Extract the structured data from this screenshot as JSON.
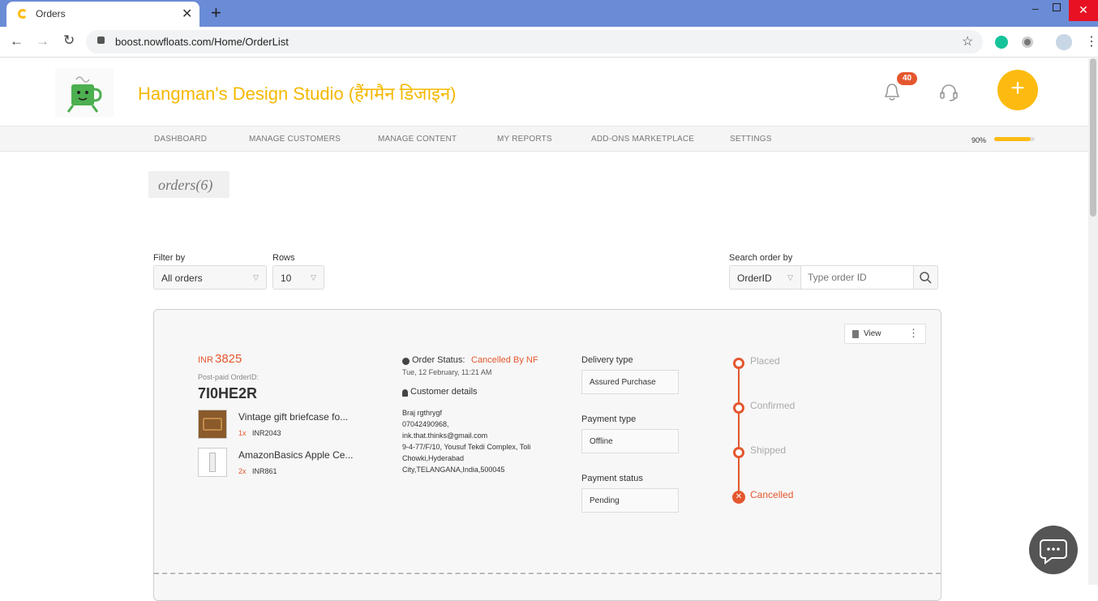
{
  "browser": {
    "tab_title": "Orders",
    "url": "boost.nowfloats.com/Home/OrderList"
  },
  "header": {
    "business_name": "Hangman's Design Studio (हैंगमैन डिजाइन)",
    "notification_count": "40",
    "fab_label": "+"
  },
  "nav": {
    "items": [
      "DASHBOARD",
      "MANAGE CUSTOMERS",
      "MANAGE CONTENT",
      "MY REPORTS",
      "ADD-ONS MARKETPLACE",
      "SETTINGS"
    ],
    "progress_label": "90%",
    "progress_value": 0.9
  },
  "page": {
    "title": "orders(6)"
  },
  "filters": {
    "filter_label": "Filter by",
    "filter_value": "All orders",
    "rows_label": "Rows",
    "rows_value": "10",
    "search_label": "Search order by",
    "search_type": "OrderID",
    "search_placeholder": "Type order ID"
  },
  "order": {
    "view_label": "View",
    "currency": "INR",
    "amount": "3825",
    "order_id_label": "Post-paid OrderID:",
    "order_id": "7I0HE2R",
    "items": [
      {
        "name": "Vintage gift briefcase fo...",
        "qty": "1x",
        "price": "INR2043"
      },
      {
        "name": "AmazonBasics Apple Ce...",
        "qty": "2x",
        "price": "INR861"
      }
    ],
    "status_label": "Order Status:",
    "status_value": "Cancelled By NF",
    "date": "Tue, 12 February, 11:21 AM",
    "customer_heading": "Customer details",
    "customer_lines": [
      "Braj rgthrygf",
      "07042490968,",
      "ink.that.thinks@gmail.com",
      "9-4-77/F/10, Yousuf Tekdi Complex, Toli",
      "Chowki,Hyderabad",
      "City,TELANGANA,India,500045"
    ],
    "delivery_type_label": "Delivery type",
    "delivery_type": "Assured Purchase",
    "payment_type_label": "Payment type",
    "payment_type": "Offline",
    "payment_status_label": "Payment status",
    "payment_status": "Pending",
    "timeline": [
      "Placed",
      "Confirmed",
      "Shipped",
      "Cancelled"
    ]
  },
  "colors": {
    "accent": "#fdbb11",
    "brand_text": "#f5b800",
    "alert": "#e4572e",
    "browser_frame": "#6a8bd6"
  }
}
